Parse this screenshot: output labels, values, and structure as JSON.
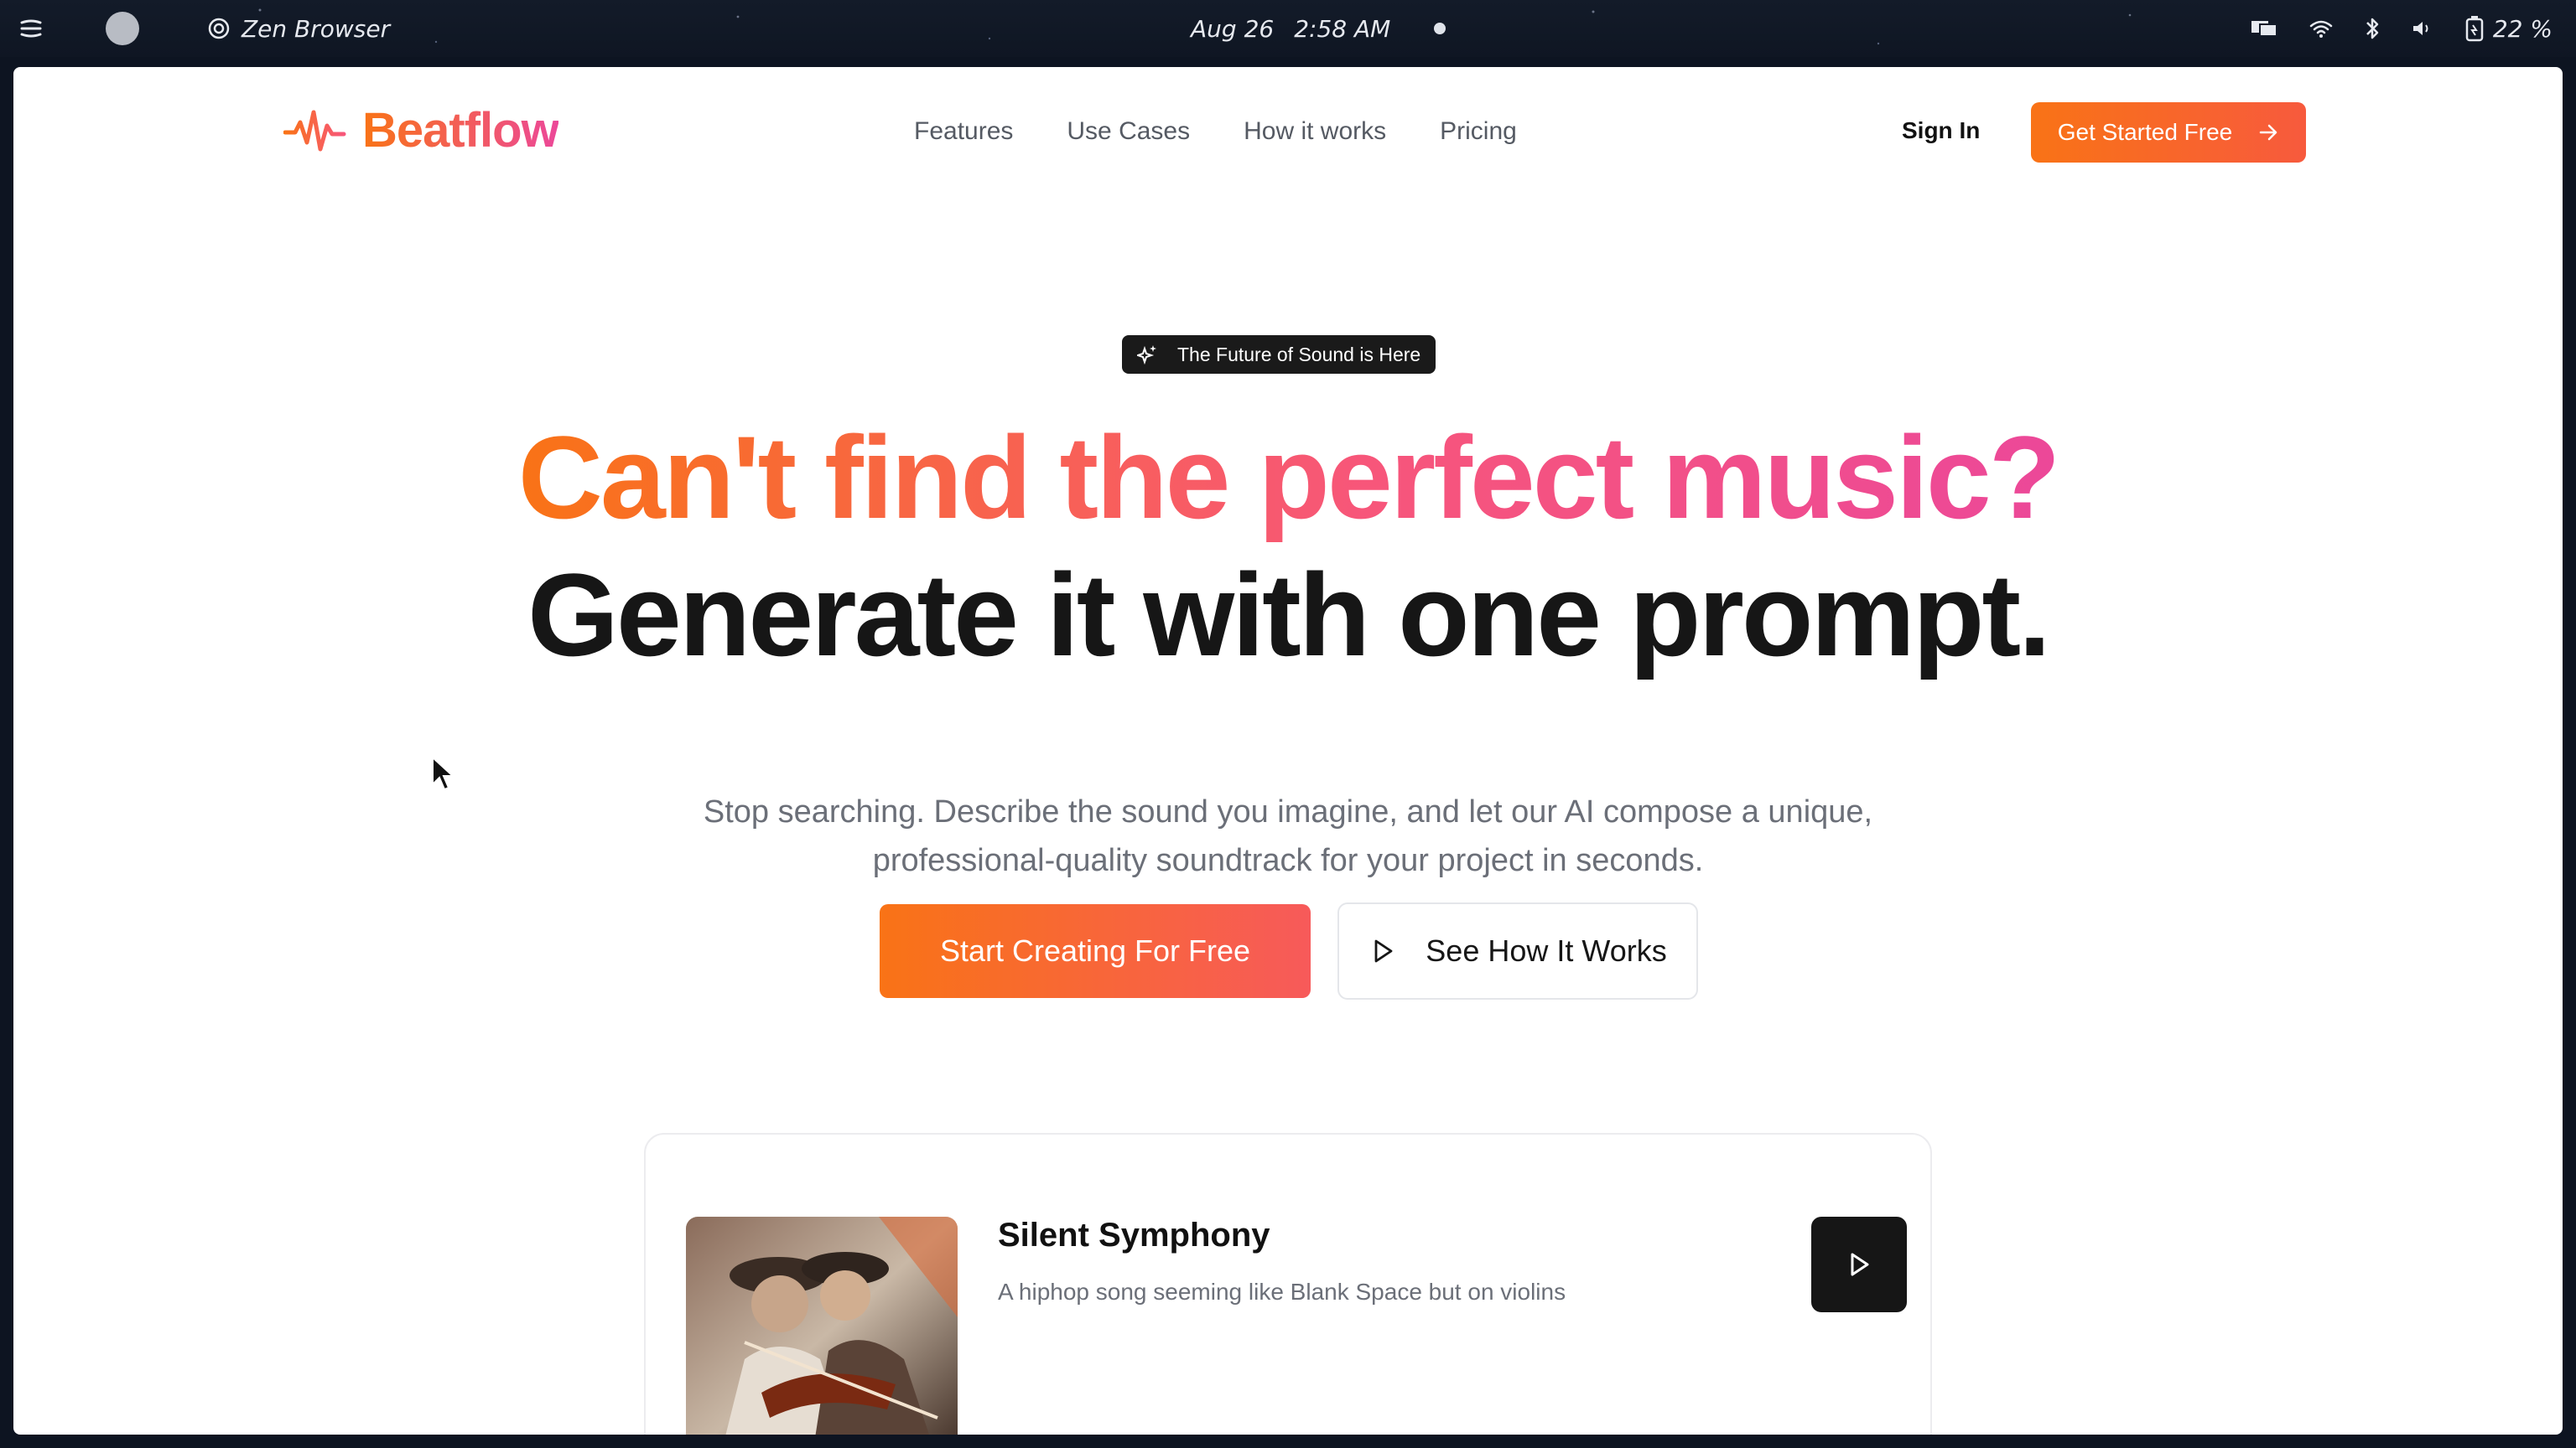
{
  "os_bar": {
    "app_name": "Zen Browser",
    "date": "Aug 26",
    "time": "2:58 AM",
    "battery": "22 %"
  },
  "nav": {
    "logo": "Beatflow",
    "links": [
      "Features",
      "Use Cases",
      "How it works",
      "Pricing"
    ],
    "sign_in": "Sign In",
    "cta": "Get Started Free"
  },
  "hero": {
    "badge": "The Future of Sound is Here",
    "headline_1": "Can't find the perfect music?",
    "headline_2": "Generate it with one prompt.",
    "subtitle_1": "Stop searching. Describe the sound you imagine, and let our AI compose a unique,",
    "subtitle_2": "professional-quality soundtrack for your project in seconds.",
    "primary_button": "Start Creating For Free",
    "secondary_button": "See How It Works"
  },
  "preview": {
    "title": "Silent Symphony",
    "description": "A hiphop song seeming like Blank Space but on violins"
  },
  "colors": {
    "accent_orange": "#f97316",
    "accent_pink": "#ec4899",
    "dark": "#161616"
  }
}
